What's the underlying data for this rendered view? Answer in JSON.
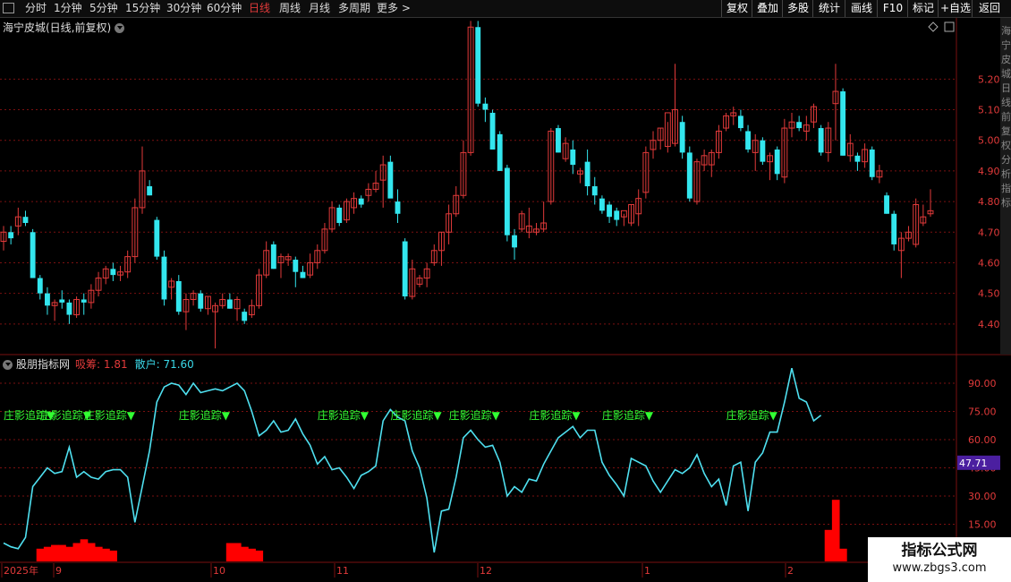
{
  "toolbar": {
    "periods": [
      "分时",
      "1分钟",
      "5分钟",
      "15分钟",
      "30分钟",
      "60分钟",
      "日线",
      "周线",
      "月线",
      "多周期",
      "更多 >"
    ],
    "active_period": "日线",
    "right_buttons": [
      "复权",
      "叠加",
      "多股",
      "统计",
      "画线",
      "F10",
      "标记",
      "+自选",
      "返回"
    ]
  },
  "main_chart": {
    "title": "海宁皮城(日线,前复权)",
    "price_ticks": [
      "5.20",
      "5.10",
      "5.00",
      "4.90",
      "4.80",
      "4.70",
      "4.60",
      "4.50",
      "4.40"
    ],
    "right_vertical_text": "海宁皮城日线前复权分析指标"
  },
  "indicator": {
    "name": "股朋指标网",
    "xichou_label": "吸筹: 1.81",
    "sanhu_label": "散户: 71.60",
    "ticks": [
      "90.00",
      "75.00",
      "60.00",
      "45.00",
      "30.00",
      "15.00"
    ],
    "current_value": "47.71",
    "signal_label": "庄影追踪▼"
  },
  "date_axis": [
    "2025年",
    "9",
    "10",
    "11",
    "12",
    "1",
    "2"
  ],
  "watermark": {
    "line1": "指标公式网",
    "line2": "www.zbgs3.com"
  },
  "colors": {
    "up": "#e23a3a",
    "down": "#33e6ee",
    "line": "#4fe0f0",
    "bar": "#ff0000",
    "signal": "#33ff33",
    "grid": "#7a1010",
    "badge": "#4b1fa0"
  },
  "chart_data": {
    "type": "candlestick",
    "price_range": [
      4.3,
      5.4
    ],
    "candles": [
      [
        4.67,
        4.72,
        4.64,
        4.7
      ],
      [
        4.7,
        4.72,
        4.66,
        4.68
      ],
      [
        4.72,
        4.78,
        4.69,
        4.75
      ],
      [
        4.75,
        4.77,
        4.72,
        4.73
      ],
      [
        4.7,
        4.71,
        4.55,
        4.55
      ],
      [
        4.55,
        4.56,
        4.48,
        4.5
      ],
      [
        4.5,
        4.52,
        4.43,
        4.46
      ],
      [
        4.46,
        4.48,
        4.41,
        4.47
      ],
      [
        4.48,
        4.51,
        4.45,
        4.47
      ],
      [
        4.47,
        4.48,
        4.4,
        4.43
      ],
      [
        4.43,
        4.49,
        4.42,
        4.48
      ],
      [
        4.48,
        4.5,
        4.43,
        4.47
      ],
      [
        4.47,
        4.53,
        4.45,
        4.51
      ],
      [
        4.51,
        4.57,
        4.49,
        4.55
      ],
      [
        4.55,
        4.59,
        4.53,
        4.58
      ],
      [
        4.58,
        4.6,
        4.54,
        4.56
      ],
      [
        4.56,
        4.59,
        4.54,
        4.57
      ],
      [
        4.57,
        4.64,
        4.55,
        4.62
      ],
      [
        4.62,
        4.81,
        4.6,
        4.78
      ],
      [
        4.78,
        4.98,
        4.76,
        4.9
      ],
      [
        4.85,
        4.87,
        4.82,
        4.82
      ],
      [
        4.74,
        4.75,
        4.61,
        4.62
      ],
      [
        4.62,
        4.64,
        4.46,
        4.48
      ],
      [
        4.52,
        4.55,
        4.48,
        4.54
      ],
      [
        4.54,
        4.56,
        4.43,
        4.44
      ],
      [
        4.44,
        4.5,
        4.38,
        4.48
      ],
      [
        4.48,
        4.51,
        4.46,
        4.5
      ],
      [
        4.5,
        4.51,
        4.44,
        4.45
      ],
      [
        4.45,
        4.49,
        4.43,
        4.49
      ],
      [
        4.44,
        4.47,
        4.32,
        4.46
      ],
      [
        4.46,
        4.5,
        4.45,
        4.48
      ],
      [
        4.48,
        4.5,
        4.45,
        4.45
      ],
      [
        4.45,
        4.49,
        4.41,
        4.48
      ],
      [
        4.44,
        4.45,
        4.4,
        4.41
      ],
      [
        4.43,
        4.48,
        4.42,
        4.46
      ],
      [
        4.46,
        4.58,
        4.45,
        4.56
      ],
      [
        4.56,
        4.67,
        4.55,
        4.64
      ],
      [
        4.66,
        4.67,
        4.58,
        4.58
      ],
      [
        4.6,
        4.63,
        4.55,
        4.62
      ],
      [
        4.61,
        4.63,
        4.59,
        4.62
      ],
      [
        4.61,
        4.62,
        4.52,
        4.57
      ],
      [
        4.57,
        4.59,
        4.55,
        4.55
      ],
      [
        4.56,
        4.63,
        4.55,
        4.6
      ],
      [
        4.6,
        4.66,
        4.58,
        4.64
      ],
      [
        4.64,
        4.73,
        4.63,
        4.71
      ],
      [
        4.71,
        4.8,
        4.7,
        4.78
      ],
      [
        4.78,
        4.79,
        4.72,
        4.73
      ],
      [
        4.74,
        4.81,
        4.73,
        4.8
      ],
      [
        4.78,
        4.83,
        4.76,
        4.81
      ],
      [
        4.81,
        4.82,
        4.78,
        4.79
      ],
      [
        4.82,
        4.86,
        4.8,
        4.84
      ],
      [
        4.84,
        4.9,
        4.83,
        4.86
      ],
      [
        4.87,
        4.95,
        4.78,
        4.92
      ],
      [
        4.93,
        4.95,
        4.86,
        4.81
      ],
      [
        4.8,
        4.84,
        4.73,
        4.76
      ],
      [
        4.67,
        4.68,
        4.48,
        4.49
      ],
      [
        4.49,
        4.61,
        4.48,
        4.58
      ],
      [
        4.53,
        4.56,
        4.52,
        4.55
      ],
      [
        4.55,
        4.6,
        4.52,
        4.58
      ],
      [
        4.6,
        4.66,
        4.59,
        4.64
      ],
      [
        4.64,
        4.7,
        4.59,
        4.7
      ],
      [
        4.7,
        4.79,
        4.66,
        4.76
      ],
      [
        4.76,
        4.85,
        4.75,
        4.82
      ],
      [
        4.82,
        5.0,
        4.81,
        4.96
      ],
      [
        4.96,
        5.39,
        4.95,
        5.37
      ],
      [
        5.37,
        5.39,
        5.11,
        5.12
      ],
      [
        5.12,
        5.14,
        5.06,
        5.1
      ],
      [
        5.09,
        5.1,
        4.97,
        4.97
      ],
      [
        5.02,
        5.03,
        4.9,
        4.9
      ],
      [
        4.91,
        4.92,
        4.67,
        4.69
      ],
      [
        4.69,
        4.71,
        4.61,
        4.65
      ],
      [
        4.71,
        4.77,
        4.7,
        4.76
      ],
      [
        4.7,
        4.78,
        4.68,
        4.72
      ],
      [
        4.7,
        4.73,
        4.69,
        4.71
      ],
      [
        4.71,
        4.8,
        4.7,
        4.73
      ],
      [
        4.8,
        5.04,
        4.79,
        5.03
      ],
      [
        5.04,
        5.05,
        4.96,
        4.96
      ],
      [
        4.94,
        5.01,
        4.93,
        4.99
      ],
      [
        4.97,
        5.0,
        4.89,
        4.92
      ],
      [
        4.89,
        4.91,
        4.86,
        4.9
      ],
      [
        4.93,
        4.97,
        4.82,
        4.85
      ],
      [
        4.85,
        4.88,
        4.79,
        4.82
      ],
      [
        4.81,
        4.82,
        4.76,
        4.77
      ],
      [
        4.79,
        4.8,
        4.73,
        4.75
      ],
      [
        4.77,
        4.78,
        4.72,
        4.74
      ],
      [
        4.75,
        4.76,
        4.72,
        4.77
      ],
      [
        4.73,
        4.79,
        4.72,
        4.79
      ],
      [
        4.76,
        4.84,
        4.72,
        4.81
      ],
      [
        4.83,
        4.98,
        4.81,
        4.96
      ],
      [
        4.97,
        5.03,
        4.94,
        5.0
      ],
      [
        5.0,
        5.04,
        4.97,
        5.04
      ],
      [
        4.98,
        5.06,
        4.96,
        5.09
      ],
      [
        4.99,
        5.25,
        4.98,
        5.1
      ],
      [
        5.06,
        5.08,
        4.94,
        4.96
      ],
      [
        4.96,
        4.98,
        4.8,
        4.81
      ],
      [
        4.8,
        4.94,
        4.79,
        4.93
      ],
      [
        4.92,
        4.97,
        4.9,
        4.95
      ],
      [
        4.92,
        4.97,
        4.88,
        4.96
      ],
      [
        4.96,
        5.05,
        4.94,
        5.03
      ],
      [
        5.04,
        5.09,
        5.03,
        5.08
      ],
      [
        5.08,
        5.11,
        5.05,
        5.09
      ],
      [
        5.08,
        5.1,
        5.03,
        5.04
      ],
      [
        5.03,
        5.05,
        4.96,
        4.97
      ],
      [
        4.96,
        5.02,
        4.9,
        5.0
      ],
      [
        5.0,
        5.01,
        4.92,
        4.93
      ],
      [
        4.93,
        4.96,
        4.87,
        4.95
      ],
      [
        4.97,
        4.98,
        4.87,
        4.89
      ],
      [
        4.88,
        5.07,
        4.86,
        5.04
      ],
      [
        5.04,
        5.09,
        5.01,
        5.06
      ],
      [
        5.06,
        5.08,
        5.03,
        5.04
      ],
      [
        5.03,
        5.08,
        5.0,
        5.05
      ],
      [
        5.06,
        5.12,
        5.04,
        5.11
      ],
      [
        5.04,
        5.05,
        4.95,
        4.96
      ],
      [
        4.96,
        5.06,
        4.93,
        5.04
      ],
      [
        5.12,
        5.25,
        5.0,
        5.16
      ],
      [
        5.16,
        5.17,
        4.95,
        4.95
      ],
      [
        4.95,
        5.02,
        4.93,
        4.99
      ],
      [
        4.95,
        4.96,
        4.9,
        4.93
      ],
      [
        4.93,
        4.99,
        4.91,
        4.97
      ],
      [
        4.97,
        4.98,
        4.87,
        4.88
      ],
      [
        4.88,
        4.92,
        4.86,
        4.9
      ],
      [
        4.82,
        4.83,
        4.76,
        4.76
      ],
      [
        4.76,
        4.77,
        4.64,
        4.66
      ],
      [
        4.64,
        4.7,
        4.55,
        4.68
      ],
      [
        4.68,
        4.72,
        4.67,
        4.7
      ],
      [
        4.66,
        4.81,
        4.65,
        4.79
      ],
      [
        4.73,
        4.79,
        4.72,
        4.75
      ],
      [
        4.76,
        4.84,
        4.75,
        4.77
      ]
    ],
    "indicator_line": [
      5,
      3,
      2,
      8,
      35,
      40,
      45,
      42,
      43,
      56,
      40,
      43,
      40,
      39,
      43,
      44,
      44,
      40,
      16,
      35,
      54,
      80,
      88,
      90,
      89,
      84,
      90,
      85,
      86,
      87,
      86,
      88,
      90,
      86,
      75,
      62,
      65,
      70,
      64,
      65,
      71,
      63,
      57,
      47,
      51,
      44,
      45,
      40,
      34,
      41,
      43,
      46,
      70,
      76,
      72,
      70,
      54,
      45,
      29,
      0,
      22,
      23,
      40,
      61,
      65,
      60,
      56,
      57,
      48,
      30,
      35,
      32,
      39,
      38,
      47,
      54,
      61,
      64,
      67,
      61,
      65,
      65,
      48,
      41,
      36,
      30,
      50,
      48,
      46,
      38,
      32,
      38,
      44,
      42,
      45,
      52,
      42,
      35,
      39,
      25,
      46,
      48,
      22,
      48,
      53,
      64,
      64,
      80,
      98,
      82,
      80,
      70,
      73
    ],
    "bars": [
      [
        5,
        2
      ],
      [
        6,
        3
      ],
      [
        7,
        4
      ],
      [
        8,
        4
      ],
      [
        9,
        3
      ],
      [
        10,
        5
      ],
      [
        11,
        7
      ],
      [
        12,
        5
      ],
      [
        13,
        3
      ],
      [
        14,
        2
      ],
      [
        15,
        1
      ],
      [
        31,
        5
      ],
      [
        32,
        5
      ],
      [
        33,
        3
      ],
      [
        34,
        2
      ],
      [
        35,
        1
      ],
      [
        113,
        12
      ],
      [
        114,
        28
      ],
      [
        115,
        2
      ]
    ],
    "signals": [
      0,
      5,
      11,
      24,
      43,
      53,
      61,
      72,
      82,
      99
    ]
  }
}
